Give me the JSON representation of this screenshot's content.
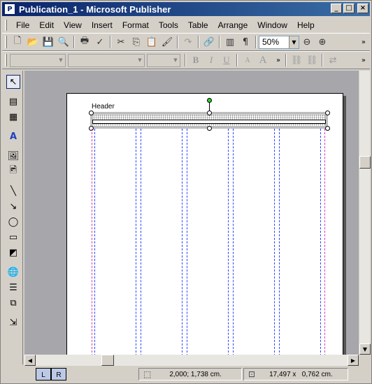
{
  "window": {
    "title": "Publication_1 - Microsoft Publisher",
    "app_icon": "publisher-icon"
  },
  "menubar": {
    "items": [
      "File",
      "Edit",
      "View",
      "Insert",
      "Format",
      "Tools",
      "Table",
      "Arrange",
      "Window",
      "Help"
    ]
  },
  "standard_toolbar": {
    "zoom_value": "50%"
  },
  "document": {
    "header_label": "Header"
  },
  "page_nav": {
    "tabs": [
      "L",
      "R"
    ]
  },
  "statusbar": {
    "position": "2,000; 1,738 cm.",
    "size": "17,497 x   0,762 cm."
  }
}
